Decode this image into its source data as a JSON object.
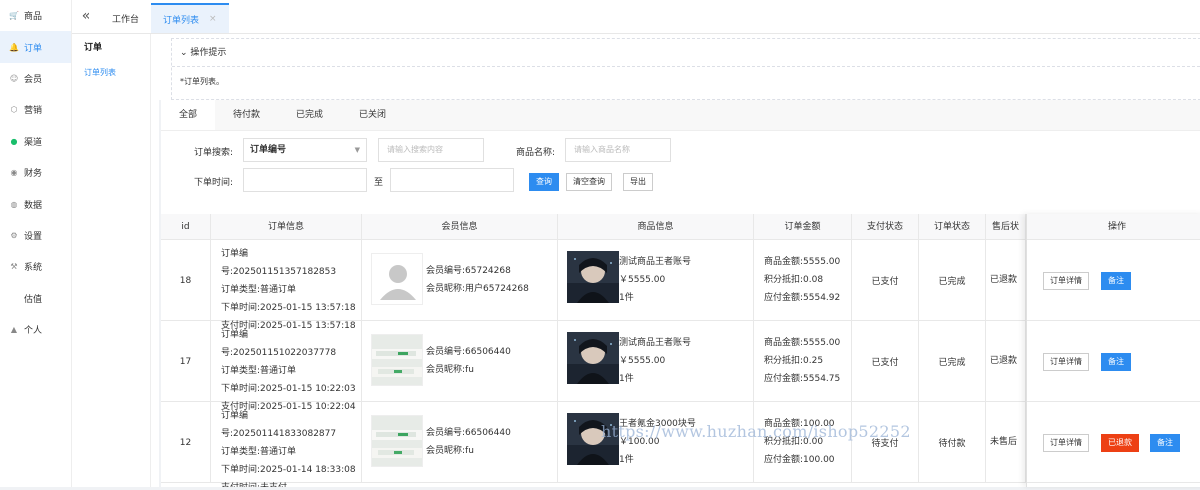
{
  "nav": [
    {
      "icon": "cart-icon",
      "glyph": "🛒",
      "label": "商品"
    },
    {
      "icon": "bell-icon",
      "glyph": "🔔",
      "label": "订单",
      "active": true
    },
    {
      "icon": "user-icon",
      "glyph": "☺",
      "label": "会员"
    },
    {
      "icon": "tag-icon",
      "glyph": "⬡",
      "label": "营销"
    },
    {
      "icon": "channel-icon",
      "glyph": "●",
      "label": "渠道",
      "green": true
    },
    {
      "icon": "finance-icon",
      "glyph": "◉",
      "label": "财务"
    },
    {
      "icon": "data-icon",
      "glyph": "◍",
      "label": "数据"
    },
    {
      "icon": "settings-icon",
      "glyph": "⚙",
      "label": "设置"
    },
    {
      "icon": "system-icon",
      "glyph": "⚒",
      "label": "系统"
    },
    {
      "icon": "",
      "glyph": "",
      "label": "估值"
    },
    {
      "icon": "person-icon",
      "glyph": "▲",
      "label": "个人"
    }
  ],
  "sub": {
    "title": "订单",
    "items": [
      "订单列表"
    ]
  },
  "tabs": {
    "home": "工作台",
    "active": "订单列表",
    "close": "×"
  },
  "tips": {
    "title": "操作提示",
    "text": "*订单列表。"
  },
  "status_tabs": [
    "全部",
    "待付款",
    "已完成",
    "已关闭"
  ],
  "filter": {
    "search_label": "订单搜索:",
    "search_type": "订单编号",
    "search_placeholder": "请输入搜索内容",
    "product_label": "商品名称:",
    "product_placeholder": "请输入商品名称",
    "time_label": "下单时间:",
    "to": "至",
    "query": "查询",
    "clear": "清空查询",
    "export": "导出"
  },
  "columns": [
    "id",
    "订单信息",
    "会员信息",
    "商品信息",
    "订单金额",
    "支付状态",
    "订单状态",
    "售后状",
    "操作"
  ],
  "rows": [
    {
      "id": "18",
      "order_no": "订单编号:202501151357182853",
      "order_type": "订单类型:普通订单",
      "order_time": "下单时间:2025-01-15 13:57:18",
      "pay_time": "支付时间:2025-01-15 13:57:18",
      "member_no": "会员编号:65724268",
      "member_name": "会员昵称:用户65724268",
      "avatar": "default",
      "product": "测试商品王者账号",
      "price": "￥5555.00",
      "qty": "1件",
      "amount": "商品金额:5555.00",
      "points": "积分抵扣:0.08",
      "payable": "应付金额:5554.92",
      "pay_status": "已支付",
      "order_status": "已完成",
      "after_sale": "已退款"
    },
    {
      "id": "17",
      "order_no": "订单编号:202501151022037778",
      "order_type": "订单类型:普通订单",
      "order_time": "下单时间:2025-01-15 10:22:03",
      "pay_time": "支付时间:2025-01-15 10:22:04",
      "member_no": "会员编号:66506440",
      "member_name": "会员昵称:fu",
      "avatar": "photo",
      "product": "测试商品王者账号",
      "price": "￥5555.00",
      "qty": "1件",
      "amount": "商品金额:5555.00",
      "points": "积分抵扣:0.25",
      "payable": "应付金额:5554.75",
      "pay_status": "已支付",
      "order_status": "已完成",
      "after_sale": "已退款"
    },
    {
      "id": "12",
      "order_no": "订单编号:202501141833082877",
      "order_type": "订单类型:普通订单",
      "order_time": "下单时间:2025-01-14 18:33:08",
      "pay_time": "支付时间:未支付",
      "member_no": "会员编号:66506440",
      "member_name": "会员昵称:fu",
      "avatar": "photo",
      "product": "王者氪金3000块号",
      "price": "￥100.00",
      "qty": "1件",
      "amount": "商品金额:100.00",
      "points": "积分抵扣:0.00",
      "payable": "应付金额:100.00",
      "pay_status": "待支付",
      "order_status": "待付款",
      "after_sale": "未售后"
    }
  ],
  "ops": {
    "detail": "订单详情",
    "refunded": "已退款",
    "note": "备注"
  },
  "watermark": "https://www.huzhan.com/ishop52252",
  "colors": {
    "accent": "#2d8cf0",
    "danger": "#ed4014",
    "green": "#19be6b"
  }
}
